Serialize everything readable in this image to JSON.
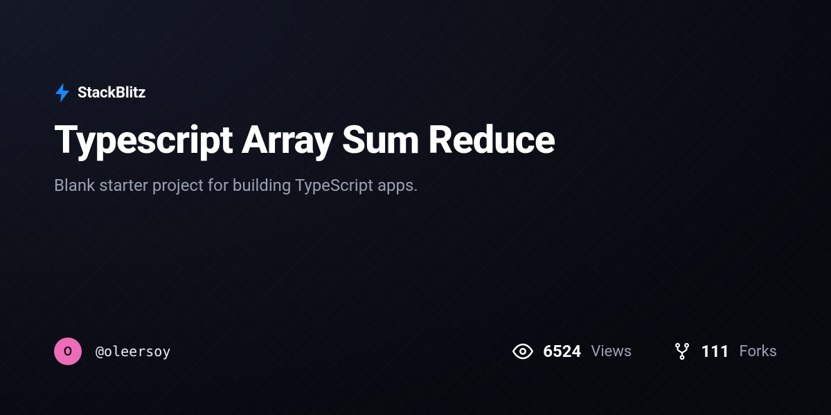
{
  "brand": {
    "name": "StackBlitz"
  },
  "project": {
    "title": "Typescript Array Sum Reduce",
    "description": "Blank starter project for building TypeScript apps."
  },
  "author": {
    "initial": "O",
    "username": "@oleersoy"
  },
  "stats": {
    "views": {
      "value": "6524",
      "label": "Views"
    },
    "forks": {
      "value": "111",
      "label": "Forks"
    }
  }
}
